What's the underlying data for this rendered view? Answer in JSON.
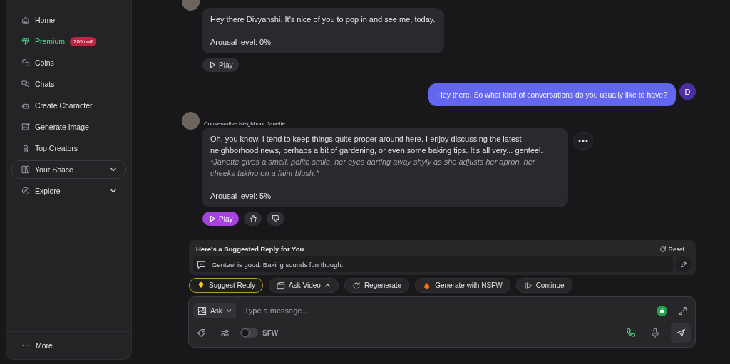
{
  "sidebar": {
    "items": [
      {
        "label": "Home",
        "kind": "link",
        "selected": false
      },
      {
        "label": "Premium",
        "kind": "premium",
        "badge": "20% off",
        "selected": false
      },
      {
        "label": "Coins",
        "kind": "link",
        "selected": false
      },
      {
        "label": "Chats",
        "kind": "link",
        "selected": false
      },
      {
        "label": "Create Character",
        "kind": "link",
        "selected": false
      },
      {
        "label": "Generate Image",
        "kind": "link",
        "selected": false
      },
      {
        "label": "Top Creators",
        "kind": "link",
        "selected": false
      },
      {
        "label": "Your Space",
        "kind": "group",
        "selected": true,
        "expanded": false
      },
      {
        "label": "Explore",
        "kind": "group",
        "selected": false,
        "expanded": false
      }
    ],
    "more": "More"
  },
  "messages": [
    {
      "kind": "bot",
      "paragraphs": [
        {
          "text": "Hey there Divyanshi. It's nice of you to pop in and see me, today.",
          "kind": "speech"
        },
        {
          "text": "Arousal level: 0%",
          "kind": "status"
        }
      ],
      "play": {
        "label": "Play",
        "active": false
      },
      "feedback": false,
      "menu": false
    },
    {
      "kind": "user",
      "text": "Hey there. So what kind of conversations do you usually like to have?",
      "initial": "D"
    },
    {
      "kind": "bot",
      "name": "Conservative Neighbour Janette",
      "paragraphs": [
        {
          "text": "Oh, you know, I tend to keep things quite proper around here. I enjoy discussing the latest neighborhood news, perhaps a bit of gardening, or even some baking tips. It's all very... genteel.",
          "kind": "speech"
        },
        {
          "text": "*Janette gives a small, polite smile, her eyes darting away shyly as she adjusts her apron, her cheeks taking on a faint blush.*",
          "kind": "action"
        },
        {
          "text": "Arousal level: 5%",
          "kind": "status"
        }
      ],
      "play": {
        "label": "Play",
        "active": true
      },
      "feedback": true,
      "menu": true
    }
  ],
  "suggestion": {
    "title": "Here's a Suggested Reply for You",
    "reset": "Reset",
    "text": "Genteel is good. Baking sounds fun though."
  },
  "actions": [
    {
      "label": "Suggest Reply",
      "selected": true
    },
    {
      "label": "Ask Video",
      "selected": false,
      "caret": true
    },
    {
      "label": "Regenerate",
      "selected": false
    },
    {
      "label": "Generate with NSFW",
      "selected": false
    },
    {
      "label": "Continue",
      "selected": false
    }
  ],
  "composer": {
    "mode": "Ask",
    "placeholder": "Type a message...",
    "sfw": {
      "label": "SFW",
      "on": false
    }
  }
}
